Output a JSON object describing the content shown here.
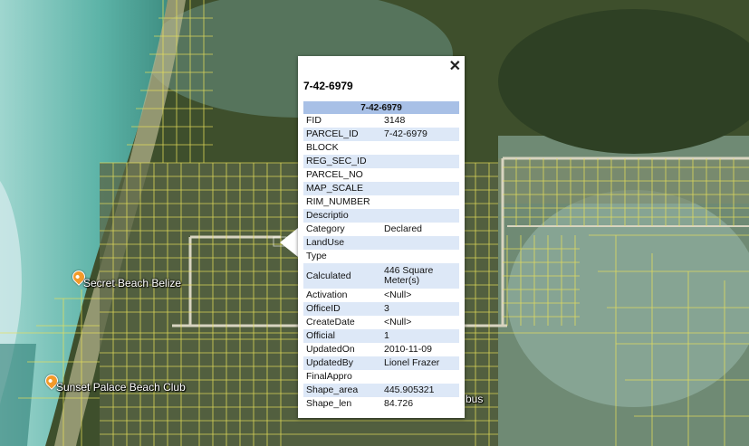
{
  "map": {
    "places": [
      {
        "label": "Secret Beach Belize"
      },
      {
        "label": "Sunset Palace Beach Club"
      },
      {
        "label": "bus"
      }
    ],
    "colors": {
      "parcel_line": "#e8e05a",
      "sea": "#5fb0a8",
      "land": "#3e4f2c"
    }
  },
  "popup": {
    "title": "7-42-6979",
    "close_label": "✕",
    "table_header": "7-42-6979",
    "rows": [
      {
        "key": "FID",
        "value": "3148"
      },
      {
        "key": "PARCEL_ID",
        "value": "7-42-6979"
      },
      {
        "key": "BLOCK",
        "value": ""
      },
      {
        "key": "REG_SEC_ID",
        "value": ""
      },
      {
        "key": "PARCEL_NO",
        "value": ""
      },
      {
        "key": "MAP_SCALE",
        "value": ""
      },
      {
        "key": "RIM_NUMBER",
        "value": ""
      },
      {
        "key": "Descriptio",
        "value": ""
      },
      {
        "key": "Category",
        "value": "Declared"
      },
      {
        "key": "LandUse",
        "value": ""
      },
      {
        "key": "Type",
        "value": ""
      },
      {
        "key": "Calculated",
        "value": "446 Square Meter(s)"
      },
      {
        "key": "Activation",
        "value": "<Null>"
      },
      {
        "key": "OfficeID",
        "value": "3"
      },
      {
        "key": "CreateDate",
        "value": "<Null>"
      },
      {
        "key": "Official",
        "value": "1"
      },
      {
        "key": "UpdatedOn",
        "value": "2010-11-09"
      },
      {
        "key": "UpdatedBy",
        "value": "Lionel Frazer"
      },
      {
        "key": "FinalAppro",
        "value": ""
      },
      {
        "key": "Shape_area",
        "value": "445.905321"
      },
      {
        "key": "Shape_len",
        "value": "84.726"
      }
    ]
  }
}
